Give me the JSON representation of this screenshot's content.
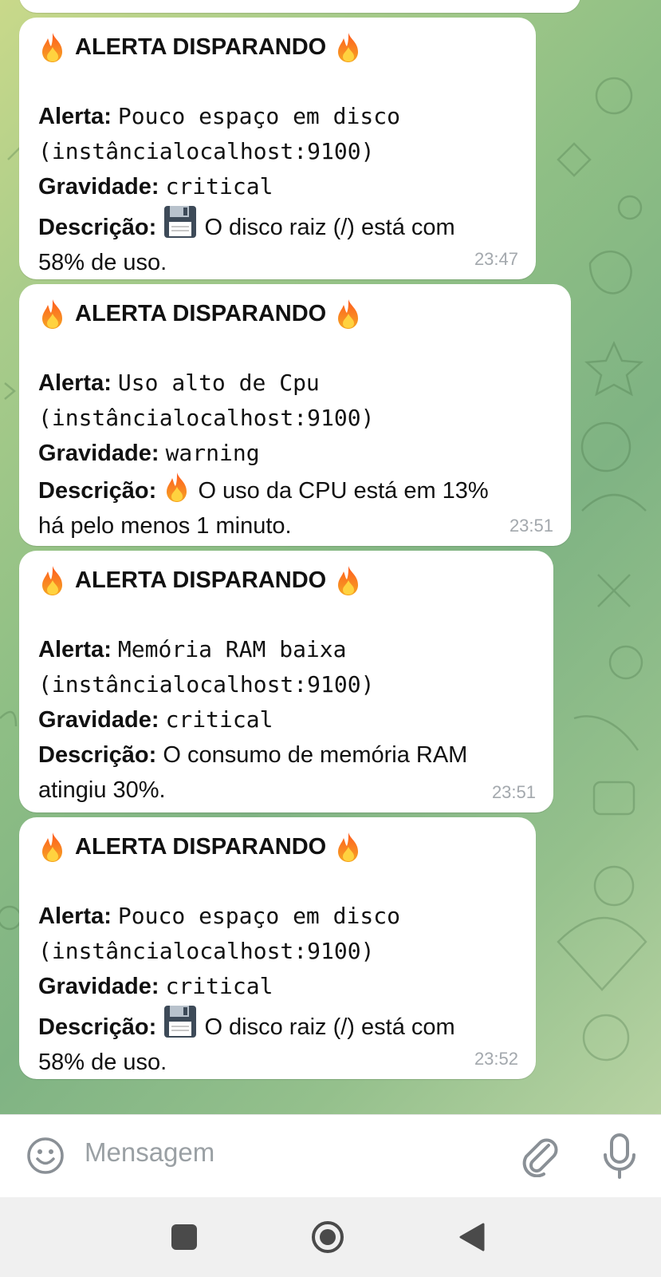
{
  "messages": [
    {
      "title": "ALERTA DISPARANDO",
      "alert_label": "Alerta:",
      "alert_name": "Pouco espaço em disco",
      "instance": "(instâncialocalhost:9100)",
      "severity_label": "Gravidade:",
      "severity": "critical",
      "desc_label": "Descrição:",
      "desc_icon": "floppy-disk-icon",
      "desc_line1": "O disco raiz (/) está com",
      "desc_line2": "58% de uso.",
      "time": "23:47"
    },
    {
      "title": "ALERTA DISPARANDO",
      "alert_label": "Alerta:",
      "alert_name": "Uso alto de Cpu",
      "instance": "(instâncialocalhost:9100)",
      "severity_label": "Gravidade:",
      "severity": "warning",
      "desc_label": "Descrição:",
      "desc_icon": "fire-icon",
      "desc_line1": "O uso da CPU está em 13%",
      "desc_line2": "há pelo menos 1 minuto.",
      "time": "23:51"
    },
    {
      "title": "ALERTA DISPARANDO",
      "alert_label": "Alerta:",
      "alert_name": "Memória RAM baixa",
      "instance": "(instâncialocalhost:9100)",
      "severity_label": "Gravidade:",
      "severity": "critical",
      "desc_label": "Descrição:",
      "desc_line1": "O consumo de memória RAM",
      "desc_line2": "atingiu 30%.",
      "time": "23:51"
    },
    {
      "title": "ALERTA DISPARANDO",
      "alert_label": "Alerta:",
      "alert_name": "Pouco espaço em disco",
      "instance": "(instâncialocalhost:9100)",
      "severity_label": "Gravidade:",
      "severity": "critical",
      "desc_label": "Descrição:",
      "desc_icon": "floppy-disk-icon",
      "desc_line1": "O disco raiz (/) está com",
      "desc_line2": "58% de uso.",
      "time": "23:52"
    }
  ],
  "composer": {
    "placeholder": "Mensagem",
    "emoji_icon": "smiley-icon",
    "attach_icon": "paperclip-icon",
    "mic_icon": "microphone-icon"
  },
  "nav": {
    "recents_icon": "square-icon",
    "home_icon": "circle-icon",
    "back_icon": "triangle-back-icon"
  },
  "colors": {
    "bubble": "#ffffff",
    "timestamp": "#a3a8ad",
    "accent_fire": "#f7791e"
  }
}
